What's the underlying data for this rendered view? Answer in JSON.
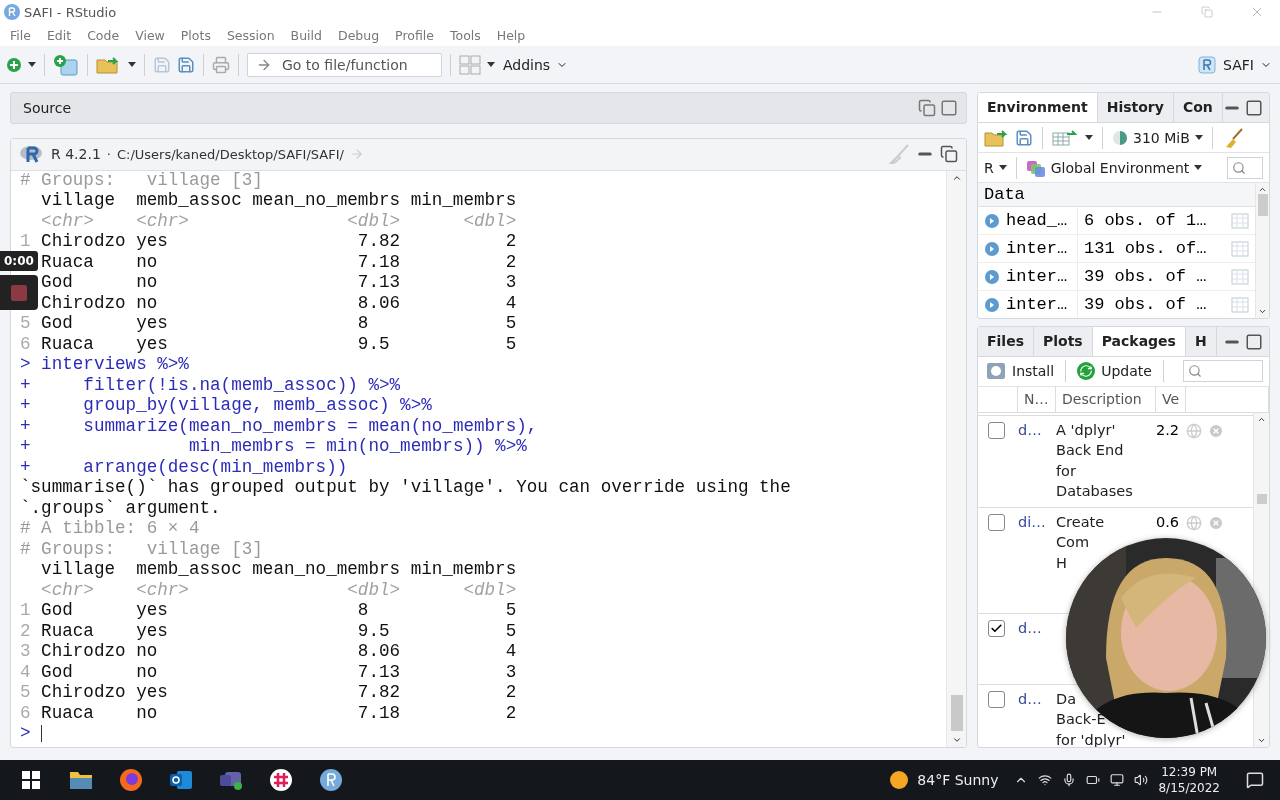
{
  "window": {
    "title": "SAFI - RStudio"
  },
  "menu": [
    "File",
    "Edit",
    "Code",
    "View",
    "Plots",
    "Session",
    "Build",
    "Debug",
    "Profile",
    "Tools",
    "Help"
  ],
  "toolbar": {
    "goto_placeholder": "Go to file/function",
    "addins": "Addins",
    "project": "SAFI"
  },
  "source_pane": {
    "title": "Source"
  },
  "console": {
    "version": "R 4.2.1",
    "separator": "·",
    "path": "C:/Users/kaned/Desktop/SAFI/SAFI/",
    "lines": [
      {
        "kind": "comment",
        "text": "# Groups:   village [3]"
      },
      {
        "kind": "header",
        "text": "village  memb_assoc mean_no_membrs min_membrs"
      },
      {
        "kind": "types",
        "text": "<chr>    <chr>               <dbl>      <dbl>"
      },
      {
        "kind": "row",
        "index": "1",
        "text": "Chirodzo yes                  7.82          2"
      },
      {
        "kind": "row",
        "text": "Ruaca    no                   7.18          2"
      },
      {
        "kind": "row",
        "text": "God      no                   7.13          3"
      },
      {
        "kind": "row",
        "text": "Chirodzo no                   8.06          4"
      },
      {
        "kind": "row",
        "index": "5",
        "text": "God      yes                  8             5"
      },
      {
        "kind": "row",
        "index": "6",
        "text": "Ruaca    yes                  9.5           5"
      },
      {
        "kind": "input",
        "text": "> interviews %>%"
      },
      {
        "kind": "input",
        "text": "+     filter(!is.na(memb_assoc)) %>%"
      },
      {
        "kind": "input",
        "text": "+     group_by(village, memb_assoc) %>%"
      },
      {
        "kind": "input",
        "text": "+     summarize(mean_no_membrs = mean(no_membrs),"
      },
      {
        "kind": "input",
        "text": "+               min_membrs = min(no_membrs)) %>%"
      },
      {
        "kind": "input",
        "text": "+     arrange(desc(min_membrs))"
      },
      {
        "kind": "message",
        "text": "`summarise()` has grouped output by 'village'. You can override using the"
      },
      {
        "kind": "message",
        "text": "`.groups` argument."
      },
      {
        "kind": "comment",
        "text": "# A tibble: 6 × 4"
      },
      {
        "kind": "comment",
        "text": "# Groups:   village [3]"
      },
      {
        "kind": "header",
        "text": "village  memb_assoc mean_no_membrs min_membrs"
      },
      {
        "kind": "types",
        "text": "<chr>    <chr>               <dbl>      <dbl>"
      },
      {
        "kind": "row",
        "index": "1",
        "text": "God      yes                  8             5"
      },
      {
        "kind": "row",
        "index": "2",
        "text": "Ruaca    yes                  9.5           5"
      },
      {
        "kind": "row",
        "index": "3",
        "text": "Chirodzo no                   8.06          4"
      },
      {
        "kind": "row",
        "index": "4",
        "text": "God      no                   7.13          3"
      },
      {
        "kind": "row",
        "index": "5",
        "text": "Chirodzo yes                  7.82          2"
      },
      {
        "kind": "row",
        "index": "6",
        "text": "Ruaca    no                   7.18          2"
      },
      {
        "kind": "prompt",
        "text": ">"
      }
    ]
  },
  "environment_pane": {
    "tabs": [
      {
        "label": "Environment",
        "selected": true
      },
      {
        "label": "History",
        "selected": false
      },
      {
        "label": "Con",
        "selected": false
      }
    ],
    "memory": "310 MiB",
    "language": "R",
    "scope": "Global Environment",
    "section": "Data",
    "objects": [
      {
        "name": "head_…",
        "value": "6 obs. of 1…"
      },
      {
        "name": "inter…",
        "value": "131 obs. of…"
      },
      {
        "name": "inter…",
        "value": "39 obs. of …"
      },
      {
        "name": "inter…",
        "value": "39 obs. of …"
      }
    ]
  },
  "files_pane": {
    "tabs": [
      {
        "label": "Files",
        "selected": false
      },
      {
        "label": "Plots",
        "selected": false
      },
      {
        "label": "Packages",
        "selected": true
      },
      {
        "label": "H",
        "selected": false
      }
    ],
    "install": "Install",
    "update": "Update",
    "columns": [
      "N…",
      "Description",
      "Ve"
    ],
    "packages": [
      {
        "checked": false,
        "name": "d…",
        "description": [
          "A 'dplyr'",
          "Back End",
          "for",
          "Databases"
        ],
        "version": "2.2"
      },
      {
        "checked": false,
        "name": "di…",
        "description": [
          "Create",
          "Com",
          "H"
        ],
        "version": "0.6"
      },
      {
        "checked": true,
        "name": "d…"
      },
      {
        "checked": false,
        "name": "d…",
        "description": [
          "Da",
          "Back-E",
          "for 'dplyr'"
        ]
      }
    ]
  },
  "recorder": {
    "time": "0:00"
  },
  "taskbar": {
    "weather": "84°F Sunny",
    "time": "12:39 PM",
    "date": "8/15/2022"
  }
}
